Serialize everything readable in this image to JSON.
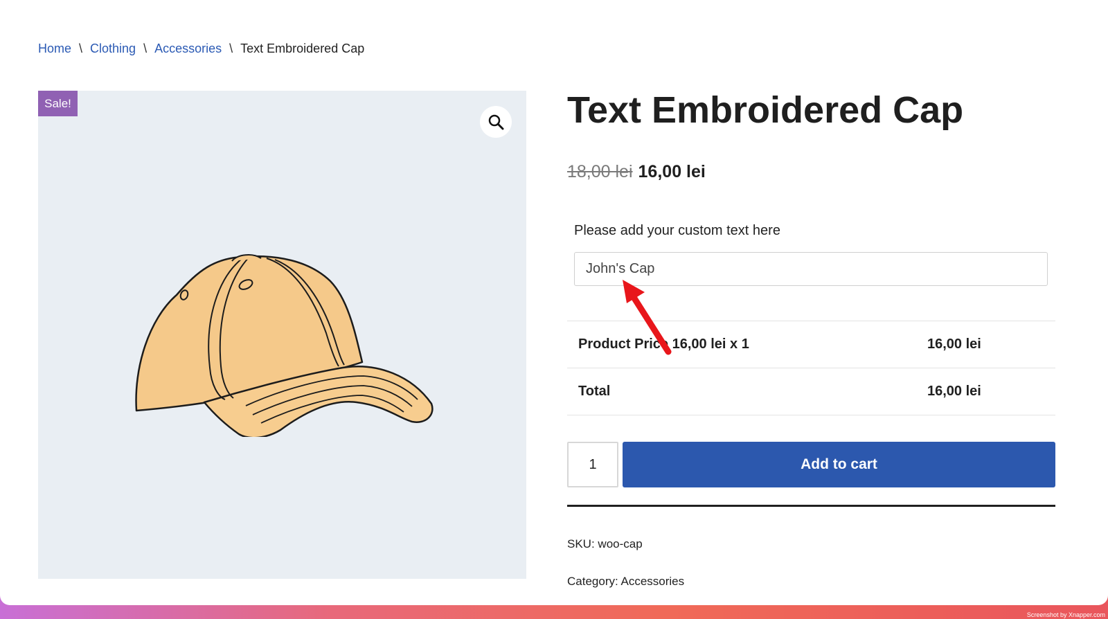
{
  "breadcrumb": {
    "home": "Home",
    "clothing": "Clothing",
    "accessories": "Accessories",
    "current": "Text Embroidered Cap",
    "separator": "\\"
  },
  "gallery": {
    "sale_badge": "Sale!",
    "zoom_icon": "magnifier-icon",
    "image_icon": "baseball-cap"
  },
  "product": {
    "title": "Text Embroidered Cap",
    "old_price": "18,00 lei",
    "new_price": "16,00 lei",
    "custom_text_label": "Please add your custom text here",
    "custom_text_value": "John's Cap",
    "price_rows": [
      {
        "label": "Product Price",
        "detail": "16,00 lei x 1",
        "value": "16,00 lei"
      },
      {
        "label": "Total",
        "detail": "",
        "value": "16,00 lei"
      }
    ],
    "quantity": "1",
    "add_to_cart": "Add to cart",
    "sku_label": "SKU:",
    "sku_value": "woo-cap",
    "category_label": "Category:",
    "category_value": "Accessories"
  },
  "annotation": {
    "arrow_color": "#e8161b"
  },
  "credit": "Screenshot by Xnapper.com",
  "colors": {
    "link": "#2b5ab4",
    "button": "#2c58ae",
    "sale_badge": "#9061b3",
    "image_bg": "#e9eef3"
  }
}
